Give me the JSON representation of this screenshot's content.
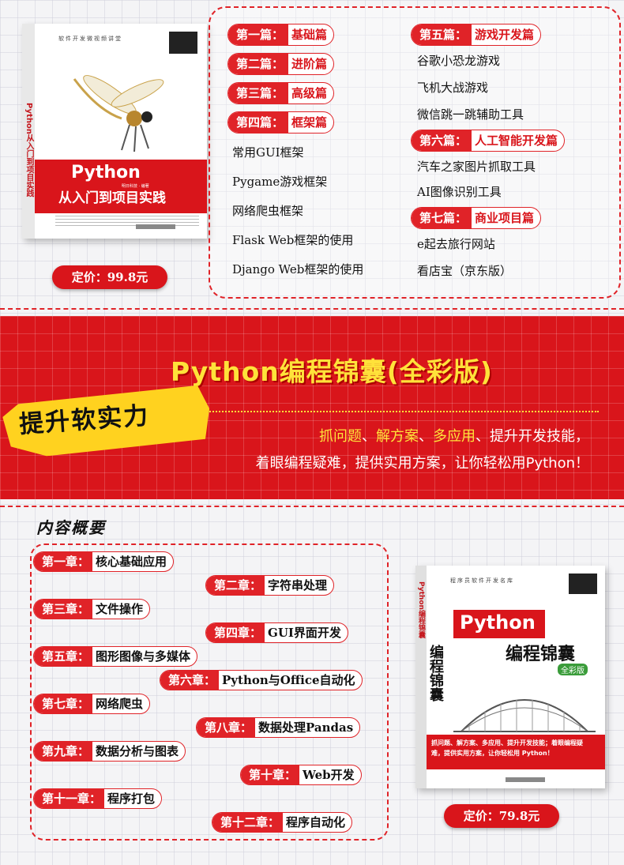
{
  "book1": {
    "series": "软件开发微视频讲堂",
    "spine": "Python从入门到项目实践",
    "title_line1": "Python",
    "title_line2": "从入门到项目实践",
    "authors": "明日科技 · 编著",
    "price": "定价：99.8元"
  },
  "parts_left": [
    {
      "prefix": "第一篇：",
      "name": "基础篇"
    },
    {
      "prefix": "第二篇：",
      "name": "进阶篇"
    },
    {
      "prefix": "第三篇：",
      "name": "高级篇"
    },
    {
      "prefix": "第四篇：",
      "name": "框架篇"
    }
  ],
  "part4_items": [
    "常用GUI框架",
    "Pygame游戏框架",
    "网络爬虫框架",
    "Flask Web框架的使用",
    "Django Web框架的使用"
  ],
  "part5": {
    "prefix": "第五篇：",
    "name": "游戏开发篇"
  },
  "part5_items": [
    "谷歌小恐龙游戏",
    "飞机大战游戏",
    "微信跳一跳辅助工具"
  ],
  "part6": {
    "prefix": "第六篇：",
    "name": "人工智能开发篇"
  },
  "part6_items": [
    "汽车之家图片抓取工具",
    "AI图像识别工具"
  ],
  "part7": {
    "prefix": "第七篇：",
    "name": "商业项目篇"
  },
  "part7_items": [
    "e起去旅行网站",
    "看店宝（京东版）"
  ],
  "banner": {
    "title": "Python编程锦囊(全彩版)",
    "slogan": "提升软实力",
    "line1_hl1": "抓问题",
    "line1_sep1": "、",
    "line1_hl2": "解方案",
    "line1_sep2": "、",
    "line1_hl3": "多应用",
    "line1_rest": "、提升开发技能，",
    "line2": "着眼编程疑难，提供实用方案，让你轻松用Python！"
  },
  "overview": {
    "heading": "内容概要",
    "chapters": [
      {
        "prefix": "第一章：",
        "name": "核心基础应用"
      },
      {
        "prefix": "第二章：",
        "name": "字符串处理"
      },
      {
        "prefix": "第三章：",
        "name": "文件操作"
      },
      {
        "prefix": "第四章：",
        "name": "GUI界面开发"
      },
      {
        "prefix": "第五章：",
        "name": "图形图像与多媒体"
      },
      {
        "prefix": "第六章：",
        "name": "Python与Office自动化"
      },
      {
        "prefix": "第七章：",
        "name": "网络爬虫"
      },
      {
        "prefix": "第八章：",
        "name": "数据处理Pandas"
      },
      {
        "prefix": "第九章：",
        "name": "数据分析与图表"
      },
      {
        "prefix": "第十章：",
        "name": "Web开发"
      },
      {
        "prefix": "第十一章：",
        "name": "程序打包"
      },
      {
        "prefix": "第十二章：",
        "name": "程序自动化"
      }
    ]
  },
  "book2": {
    "series": "程序员软件开发名库",
    "spine": "Python编程锦囊",
    "title_en": "Python",
    "title_cn": "编程锦囊",
    "title_vertical": "编程锦囊",
    "color_badge": "全彩版",
    "band_text": "抓问题、解方案、多应用、提升开发技能；着眼编程疑难，提供实用方案，让你轻松用 Python！",
    "price": "定价：79.8元"
  }
}
